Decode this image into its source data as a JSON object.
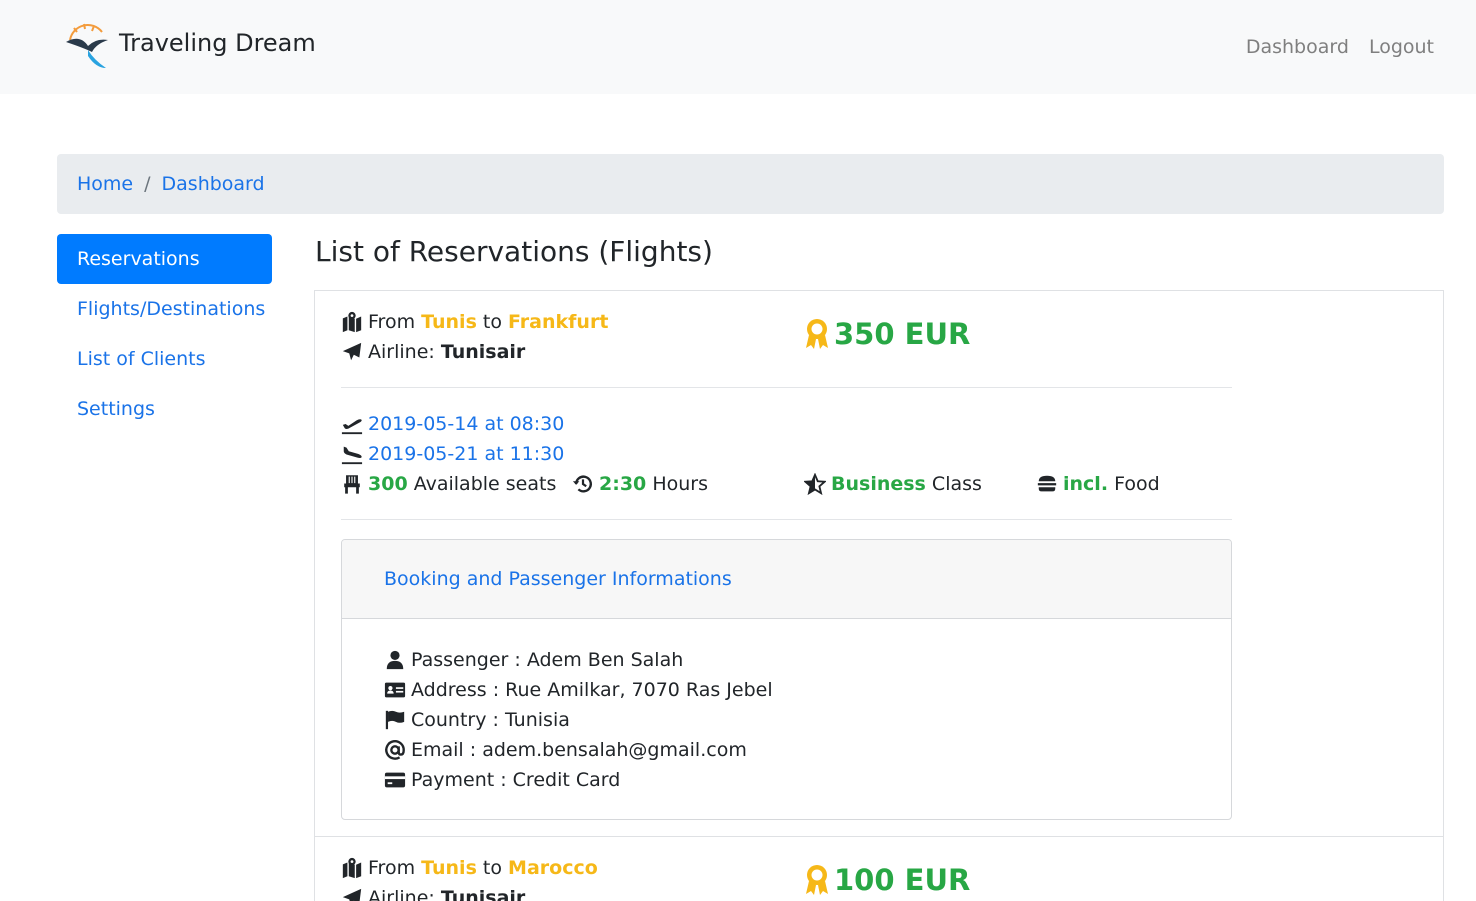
{
  "brand": {
    "name": "Traveling Dream"
  },
  "nav": {
    "dashboard": "Dashboard",
    "logout": "Logout"
  },
  "breadcrumb": {
    "home": "Home",
    "separator": "/",
    "current": "Dashboard"
  },
  "sidebar": {
    "items": [
      {
        "label": "Reservations",
        "active": true
      },
      {
        "label": "Flights/Destinations",
        "active": false
      },
      {
        "label": "List of Clients",
        "active": false
      },
      {
        "label": "Settings",
        "active": false
      }
    ]
  },
  "page": {
    "title": "List of Reservations (Flights)"
  },
  "reservations": [
    {
      "from_label": "From",
      "origin": "Tunis",
      "to_label": "to",
      "destination": "Frankfurt",
      "airline_label": "Airline:",
      "airline": "Tunisair",
      "price": "350 EUR",
      "departure": "2019-05-14 at 08:30",
      "arrival": "2019-05-21 at 11:30",
      "seats": "300",
      "seats_label": "Available seats",
      "duration": "2:30",
      "duration_label": "Hours",
      "class": "Business",
      "class_label": "Class",
      "food": "incl.",
      "food_label": "Food",
      "booking": {
        "title": "Booking and Passenger Informations",
        "passenger": "Passenger : Adem Ben Salah",
        "address": "Address : Rue Amilkar, 7070 Ras Jebel",
        "country": "Country : Tunisia",
        "email": "Email : adem.bensalah@gmail.com",
        "payment": "Payment : Credit Card"
      }
    },
    {
      "from_label": "From",
      "origin": "Tunis",
      "to_label": "to",
      "destination": "Marocco",
      "airline_label": "Airline:",
      "airline": "Tunisair",
      "price": "100 EUR"
    }
  ],
  "colors": {
    "accent": "#007bff",
    "link": "#1a73e8",
    "highlight": "#f6b818",
    "success": "#28a745",
    "navbar": "#f8f9fa"
  },
  "icons": [
    "logo-bird-icon",
    "map-marked-icon",
    "paper-plane-icon",
    "award-icon",
    "plane-departure-icon",
    "plane-arrival-icon",
    "seat-icon",
    "history-icon",
    "star-half-icon",
    "hamburger-icon",
    "user-icon",
    "id-card-icon",
    "flag-icon",
    "at-icon",
    "credit-card-icon"
  ]
}
